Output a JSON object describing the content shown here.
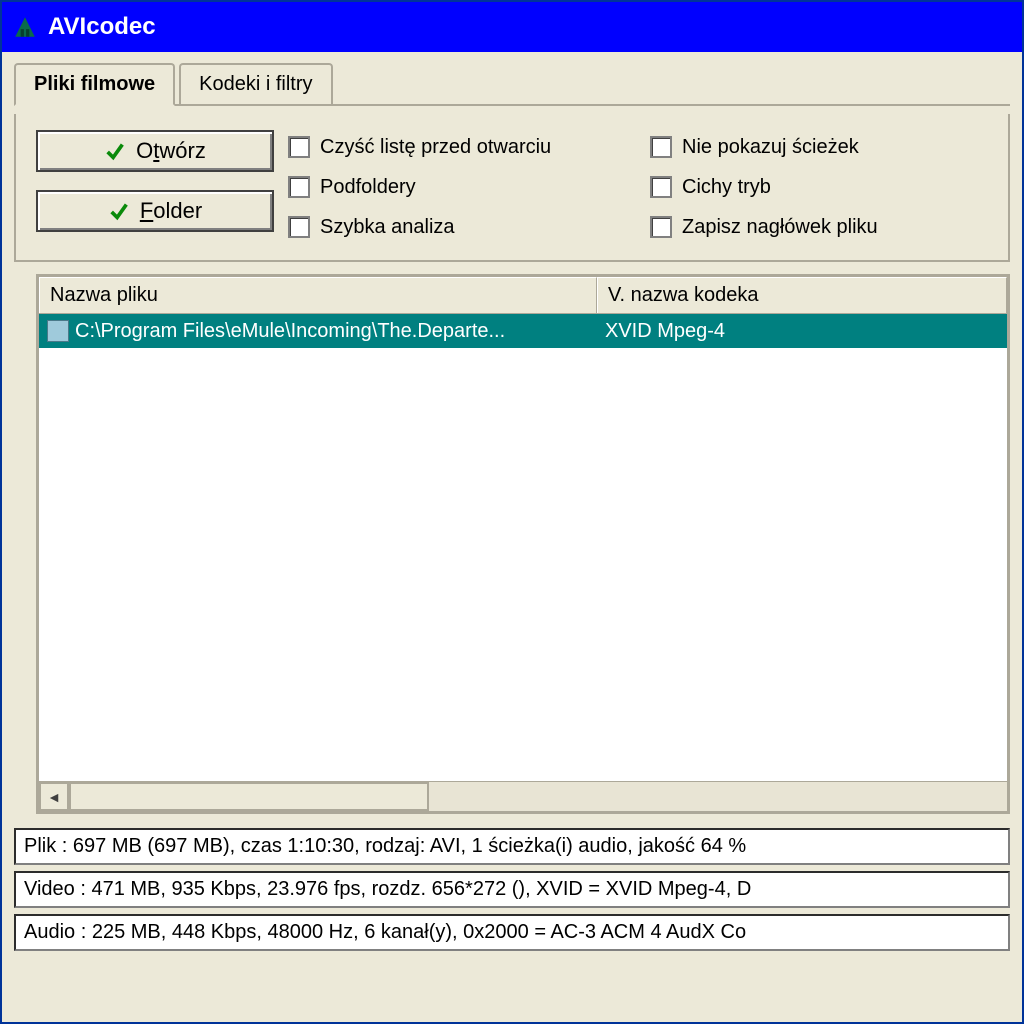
{
  "window": {
    "title": "AVIcodec"
  },
  "tabs": {
    "movies": "Pliki filmowe",
    "codecs": "Kodeki i filtry"
  },
  "buttons": {
    "open_prefix": "O",
    "open_u": "t",
    "open_suffix": "wórz",
    "folder_u": "F",
    "folder_suffix": "older"
  },
  "checks": {
    "clear_list": "Czyść listę przed otwarciu",
    "no_paths": "Nie pokazuj ścieżek",
    "subfolders": "Podfoldery",
    "quiet": "Cichy tryb",
    "fast": "Szybka analiza",
    "save_header": "Zapisz nagłówek pliku"
  },
  "list": {
    "col_filename": "Nazwa pliku",
    "col_codec": "V. nazwa kodeka",
    "rows": [
      {
        "path": "C:\\Program Files\\eMule\\Incoming\\The.Departe...",
        "codec": "XVID Mpeg-4"
      }
    ]
  },
  "info": {
    "file": "Plik : 697 MB (697 MB), czas 1:10:30, rodzaj: AVI, 1 ścieżka(i) audio, jakość 64 %",
    "video": "Video : 471 MB, 935 Kbps, 23.976 fps, rozdz. 656*272 (), XVID = XVID Mpeg-4, D",
    "audio": "Audio : 225 MB, 448 Kbps, 48000 Hz, 6 kanał(y), 0x2000 = AC-3 ACM 4 AudX Co"
  },
  "colors": {
    "titlebar": "#0000ff",
    "selection": "#008080",
    "face": "#ece9d8"
  }
}
